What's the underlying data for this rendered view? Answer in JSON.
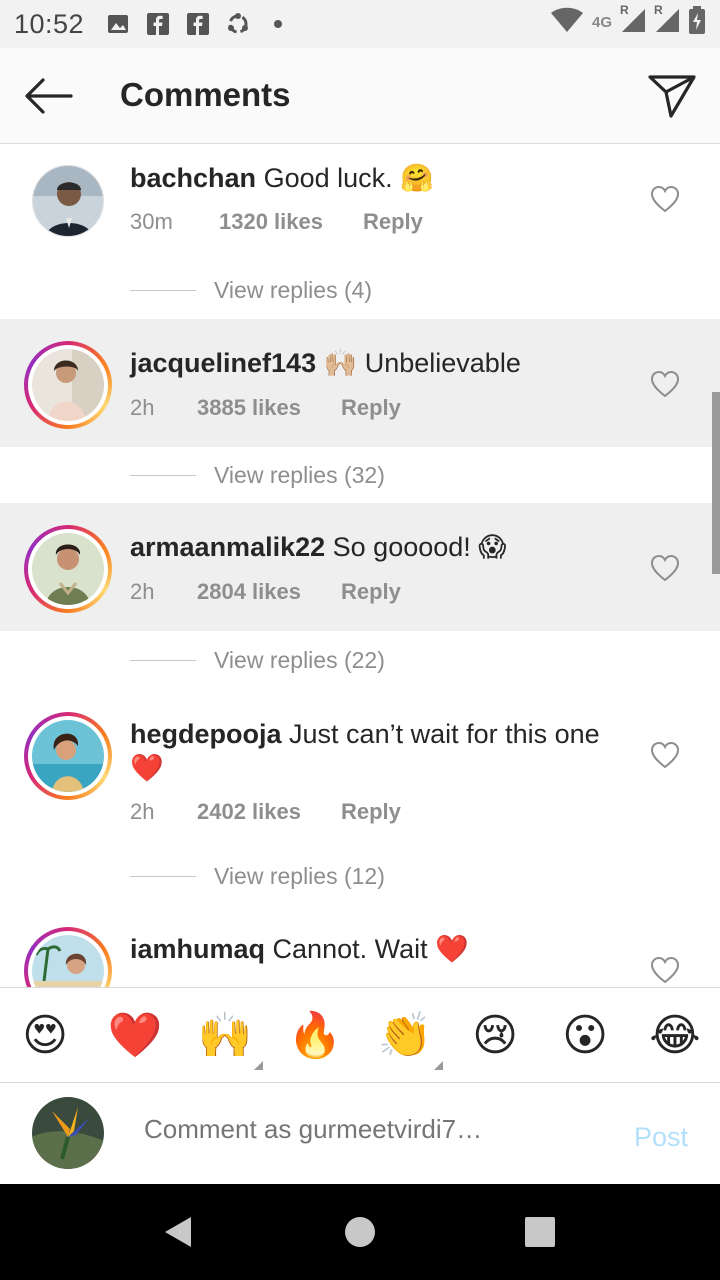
{
  "status_bar": {
    "time": "10:52",
    "network": "4G",
    "roaming_badge": "R",
    "left_icons": [
      "image-icon",
      "facebook-icon",
      "facebook-icon",
      "sync-icon",
      "dot-icon"
    ],
    "right_icons": [
      "wifi-icon",
      "signal-icon",
      "signal-icon",
      "battery-charging-icon"
    ]
  },
  "header": {
    "title": "Comments",
    "back_icon": "arrow-left-icon",
    "share_icon": "paper-plane-icon"
  },
  "comments": [
    {
      "username": "bachchan",
      "text": "Good luck. 🤗",
      "time": "30m",
      "likes": "1320 likes",
      "reply_label": "Reply",
      "view_replies": "View replies (4)",
      "highlighted": false,
      "story_ring": false
    },
    {
      "username": "jacquelinef143",
      "text": "🙌🏼 Unbelievable",
      "time": "2h",
      "likes": "3885 likes",
      "reply_label": "Reply",
      "view_replies": "View replies (32)",
      "highlighted": true,
      "story_ring": true
    },
    {
      "username": "armaanmalik22",
      "text": "So gooood! 😱",
      "time": "2h",
      "likes": "2804 likes",
      "reply_label": "Reply",
      "view_replies": "View replies (22)",
      "highlighted": true,
      "story_ring": true
    },
    {
      "username": "hegdepooja",
      "text": "Just can’t wait for this one ❤️",
      "time": "2h",
      "likes": "2402 likes",
      "reply_label": "Reply",
      "view_replies": "View replies (12)",
      "highlighted": false,
      "story_ring": true
    },
    {
      "username": "iamhumaq",
      "text": "Cannot. Wait ❤️",
      "highlighted": false,
      "story_ring": true
    }
  ],
  "emoji_bar": [
    "😍",
    "❤️",
    "🙌",
    "🔥",
    "👏",
    "😢",
    "😮",
    "😂"
  ],
  "composer": {
    "placeholder": "Comment as gurmeetvirdi7…",
    "post_label": "Post"
  },
  "nav": [
    "back-triangle-icon",
    "home-circle-icon",
    "recents-square-icon"
  ],
  "colors": {
    "accent_disabled": "#b2dffc",
    "highlight_bg": "#efefef",
    "muted_text": "#8e8e8e"
  }
}
